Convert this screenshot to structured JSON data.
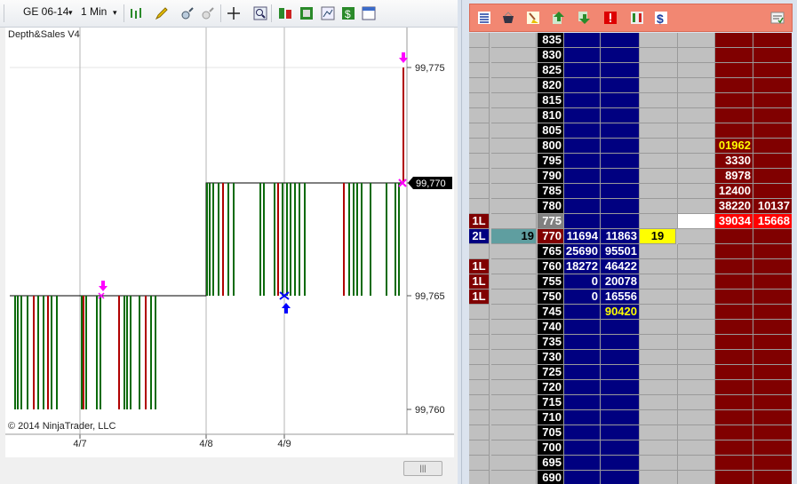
{
  "toolbar": {
    "instrument": "GE 06-14",
    "interval": "1 Min",
    "dropdown_glyph": "▾",
    "icons": [
      "bar-style-icon",
      "pencil-draw-icon",
      "zoom-in-icon",
      "zoom-out-icon",
      "crosshair-icon",
      "magnifier-icon",
      "strategy-icon",
      "indicator-icon",
      "chart-lines-icon",
      "dollar-icon",
      "properties-icon"
    ]
  },
  "chart": {
    "title": "Depth&Sales V4",
    "copyright": "© 2014 NinjaTrader, LLC",
    "price_labels": [
      "99,775",
      "99,770",
      "99,765",
      "99,760"
    ],
    "current_price": "99,770",
    "date_labels": [
      "4/7",
      "4/8",
      "4/9"
    ],
    "marker_colors": {
      "down_arrow": "#ff00ff",
      "up_arrow": "#0000ff"
    },
    "colors": {
      "up_bar": "#0b6b0b",
      "down_bar": "#b00000",
      "price_line": "#000000",
      "date_grid": "#b5b5b5"
    }
  },
  "hscroll": {
    "thumb_glyph": "|||"
  },
  "dom": {
    "toolbar_icons": [
      "ladder-center-icon",
      "basket-icon",
      "broom-icon",
      "buy-icon",
      "sell-icon",
      "alert-icon",
      "pause-icon",
      "dollar-icon",
      "settings-icon"
    ],
    "rows": [
      {
        "orders": "",
        "bid": "",
        "price": "835",
        "bidsize": "",
        "asksize": "",
        "ask": "",
        "ask1": "",
        "ask2": ""
      },
      {
        "orders": "",
        "bid": "",
        "price": "830",
        "bidsize": "",
        "asksize": "",
        "ask": "",
        "ask1": "",
        "ask2": ""
      },
      {
        "orders": "",
        "bid": "",
        "price": "825",
        "bidsize": "",
        "asksize": "",
        "ask": "",
        "ask1": "",
        "ask2": ""
      },
      {
        "orders": "",
        "bid": "",
        "price": "820",
        "bidsize": "",
        "asksize": "",
        "ask": "",
        "ask1": "",
        "ask2": ""
      },
      {
        "orders": "",
        "bid": "",
        "price": "815",
        "bidsize": "",
        "asksize": "",
        "ask": "",
        "ask1": "",
        "ask2": ""
      },
      {
        "orders": "",
        "bid": "",
        "price": "810",
        "bidsize": "",
        "asksize": "",
        "ask": "",
        "ask1": "",
        "ask2": ""
      },
      {
        "orders": "",
        "bid": "",
        "price": "805",
        "bidsize": "",
        "asksize": "",
        "ask": "",
        "ask1": "",
        "ask2": ""
      },
      {
        "orders": "",
        "bid": "",
        "price": "800",
        "bidsize": "",
        "asksize": "",
        "ask": "",
        "ask1": "01962",
        "ask2": ""
      },
      {
        "orders": "",
        "bid": "",
        "price": "795",
        "bidsize": "",
        "asksize": "",
        "ask": "",
        "ask1": "3330",
        "ask2": ""
      },
      {
        "orders": "",
        "bid": "",
        "price": "790",
        "bidsize": "",
        "asksize": "",
        "ask": "",
        "ask1": "8978",
        "ask2": ""
      },
      {
        "orders": "",
        "bid": "",
        "price": "785",
        "bidsize": "",
        "asksize": "",
        "ask": "",
        "ask1": "12400",
        "ask2": ""
      },
      {
        "orders": "",
        "bid": "",
        "price": "780",
        "bidsize": "",
        "asksize": "",
        "ask": "",
        "ask1": "38220",
        "ask2": "10137"
      },
      {
        "orders": "1L",
        "bid": "",
        "price": "775",
        "bidsize": "",
        "asksize": "",
        "ask": "",
        "ask1": "39034",
        "ask2": "15668"
      },
      {
        "orders": "2L",
        "bid": "19",
        "price": "770",
        "bidsize": "11694",
        "asksize": "11863",
        "ask": "19",
        "ask1": "",
        "ask2": ""
      },
      {
        "orders": "",
        "bid": "",
        "price": "765",
        "bidsize": "25690",
        "asksize": "95501",
        "ask": "",
        "ask1": "",
        "ask2": ""
      },
      {
        "orders": "1L",
        "bid": "",
        "price": "760",
        "bidsize": "18272",
        "asksize": "46422",
        "ask": "",
        "ask1": "",
        "ask2": ""
      },
      {
        "orders": "1L",
        "bid": "",
        "price": "755",
        "bidsize": "0",
        "asksize": "20078",
        "ask": "",
        "ask1": "",
        "ask2": ""
      },
      {
        "orders": "1L",
        "bid": "",
        "price": "750",
        "bidsize": "0",
        "asksize": "16556",
        "ask": "",
        "ask1": "",
        "ask2": ""
      },
      {
        "orders": "",
        "bid": "",
        "price": "745",
        "bidsize": "",
        "asksize": "90420",
        "ask": "",
        "ask1": "",
        "ask2": ""
      },
      {
        "orders": "",
        "bid": "",
        "price": "740",
        "bidsize": "",
        "asksize": "",
        "ask": "",
        "ask1": "",
        "ask2": ""
      },
      {
        "orders": "",
        "bid": "",
        "price": "735",
        "bidsize": "",
        "asksize": "",
        "ask": "",
        "ask1": "",
        "ask2": ""
      },
      {
        "orders": "",
        "bid": "",
        "price": "730",
        "bidsize": "",
        "asksize": "",
        "ask": "",
        "ask1": "",
        "ask2": ""
      },
      {
        "orders": "",
        "bid": "",
        "price": "725",
        "bidsize": "",
        "asksize": "",
        "ask": "",
        "ask1": "",
        "ask2": ""
      },
      {
        "orders": "",
        "bid": "",
        "price": "720",
        "bidsize": "",
        "asksize": "",
        "ask": "",
        "ask1": "",
        "ask2": ""
      },
      {
        "orders": "",
        "bid": "",
        "price": "715",
        "bidsize": "",
        "asksize": "",
        "ask": "",
        "ask1": "",
        "ask2": ""
      },
      {
        "orders": "",
        "bid": "",
        "price": "710",
        "bidsize": "",
        "asksize": "",
        "ask": "",
        "ask1": "",
        "ask2": ""
      },
      {
        "orders": "",
        "bid": "",
        "price": "705",
        "bidsize": "",
        "asksize": "",
        "ask": "",
        "ask1": "",
        "ask2": ""
      },
      {
        "orders": "",
        "bid": "",
        "price": "700",
        "bidsize": "",
        "asksize": "",
        "ask": "",
        "ask1": "",
        "ask2": ""
      },
      {
        "orders": "",
        "bid": "",
        "price": "695",
        "bidsize": "",
        "asksize": "",
        "ask": "",
        "ask1": "",
        "ask2": ""
      },
      {
        "orders": "",
        "bid": "",
        "price": "690",
        "bidsize": "",
        "asksize": "",
        "ask": "",
        "ask1": "",
        "ask2": ""
      }
    ],
    "colors": {
      "price_col": "#000000",
      "bid_cols": "#000080",
      "ask_cols": "#800000",
      "empty": "#c0c0c0",
      "last_price": "#800000",
      "highlight_text": "#ffff00"
    }
  }
}
